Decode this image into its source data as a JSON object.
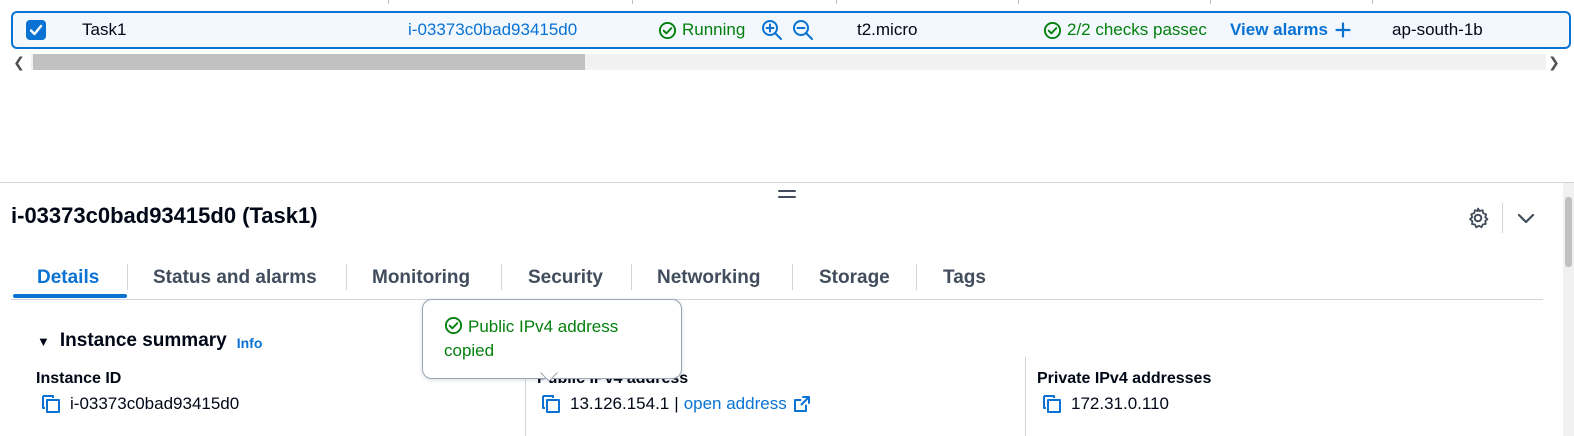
{
  "row": {
    "name": "Task1",
    "instance_id": "i-03373c0bad93415d0",
    "state": "Running",
    "type": "t2.micro",
    "status_check": "2/2 checks passec",
    "alarm_link": "View alarms",
    "az": "ap-south-1b",
    "selected": true
  },
  "panel": {
    "title": "i-03373c0bad93415d0 (Task1)",
    "tabs": [
      "Details",
      "Status and alarms",
      "Monitoring",
      "Security",
      "Networking",
      "Storage",
      "Tags"
    ],
    "active_tab": "Details"
  },
  "summary": {
    "heading": "Instance summary",
    "info": "Info",
    "instance_id_label": "Instance ID",
    "instance_id_value": "i-03373c0bad93415d0",
    "public_ip_label": "Public IPv4 address",
    "public_ip_value": "13.126.154.1",
    "public_ip_sep": "|",
    "open_address": "open address",
    "private_ip_label": "Private IPv4 addresses",
    "private_ip_value": "172.31.0.110"
  },
  "popover": {
    "message": "Public IPv4 address copied"
  },
  "colors": {
    "accent": "#0972d3",
    "success": "#037f0c",
    "text": "#000716"
  },
  "icons": [
    "checkbox-checked-icon",
    "zoom-in-icon",
    "zoom-out-icon",
    "status-ok-icon",
    "plus-icon",
    "settings-icon",
    "chevron-down-icon",
    "copy-icon",
    "external-link-icon",
    "drag-handle-icon"
  ]
}
